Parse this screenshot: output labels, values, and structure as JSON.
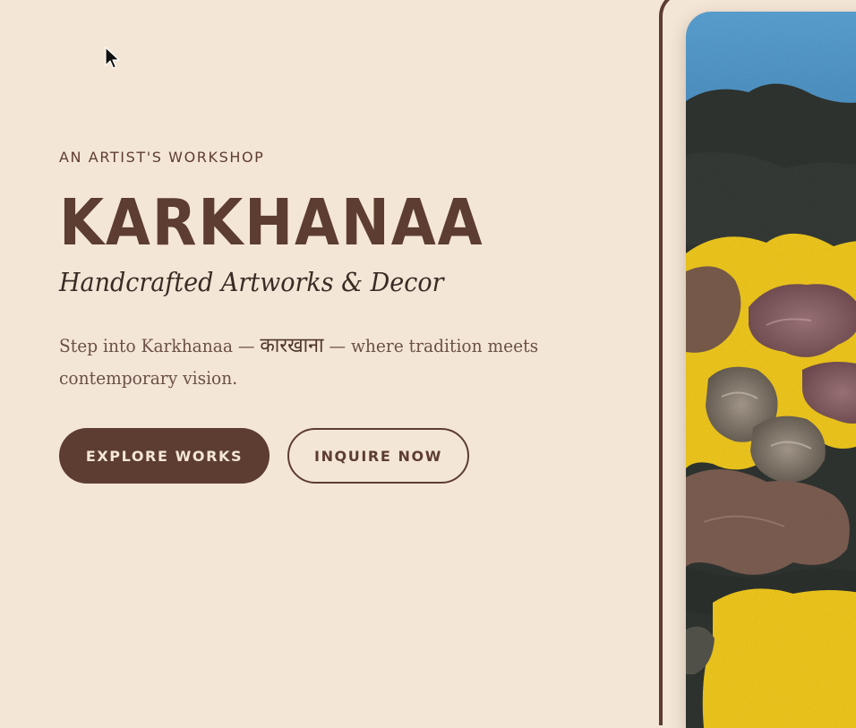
{
  "hero": {
    "eyebrow": "AN ARTIST'S WORKSHOP",
    "title": "KARKHANAA",
    "subtitle": "Handcrafted Artworks & Decor",
    "tagline": {
      "before": "Step into Karkhanaa —",
      "devanagari": "कारखाना",
      "after": "— where tradition meets contemporary vision."
    },
    "buttons": {
      "explore_label": "EXPLORE WORKS",
      "inquire_label": "INQUIRE NOW"
    }
  },
  "colors": {
    "background": "#f4e6d6",
    "brand_brown": "#5d3d31",
    "art_yellow": "#f0c81c",
    "art_sky": "#5a9fd0",
    "art_dark": "#2e3230"
  },
  "icons": {
    "cursor": "mouse-pointer-icon"
  }
}
